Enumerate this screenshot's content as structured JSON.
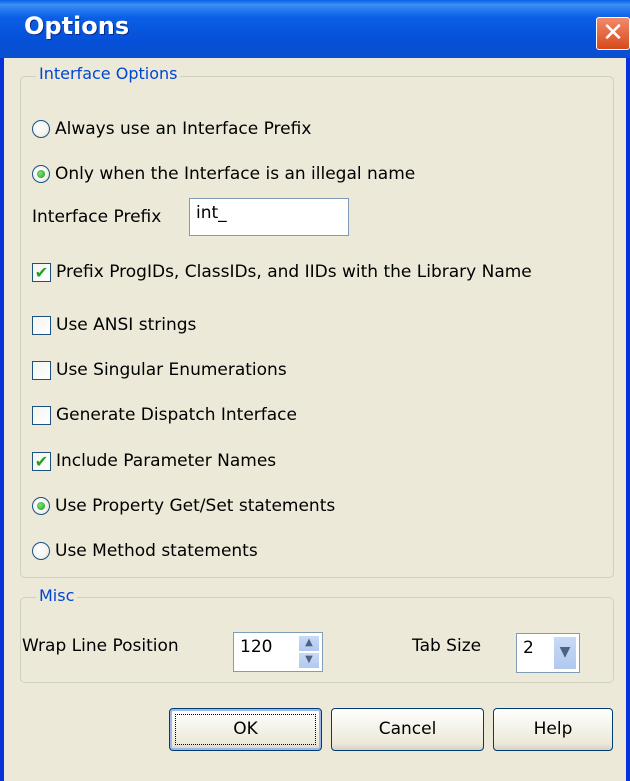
{
  "window": {
    "title": "Options",
    "close_glyph": "✕"
  },
  "interface_options": {
    "legend": "Interface Options",
    "always_prefix": {
      "label": "Always use an Interface Prefix",
      "selected": false
    },
    "only_illegal": {
      "label": "Only when the Interface is an illegal name",
      "selected": true
    },
    "prefix_label": "Interface Prefix",
    "prefix_value": "int_",
    "prefix_ids": {
      "label": "Prefix ProgIDs, ClassIDs, and IIDs with the Library Name",
      "checked": true
    },
    "ansi_strings": {
      "label": "Use ANSI strings",
      "checked": false
    },
    "singular_enums": {
      "label": "Use Singular Enumerations",
      "checked": false
    },
    "dispatch_interface": {
      "label": "Generate Dispatch Interface",
      "checked": false
    },
    "param_names": {
      "label": "Include Parameter Names",
      "checked": true
    },
    "property_getset": {
      "label": "Use Property Get/Set statements",
      "selected": true
    },
    "method_statements": {
      "label": "Use Method statements",
      "selected": false
    }
  },
  "misc": {
    "legend": "Misc",
    "wrap_label": "Wrap Line Position",
    "wrap_value": "120",
    "tab_label": "Tab Size",
    "tab_value": "2"
  },
  "buttons": {
    "ok": "OK",
    "cancel": "Cancel",
    "help": "Help"
  },
  "icons": {
    "checkmark": "✔",
    "spin_up": "▲",
    "spin_down": "▼",
    "dropdown": "▼"
  },
  "colors": {
    "titlebar": "#0a5fe6",
    "legend_text": "#0046d5",
    "dialog_bg": "#ece9d8"
  }
}
